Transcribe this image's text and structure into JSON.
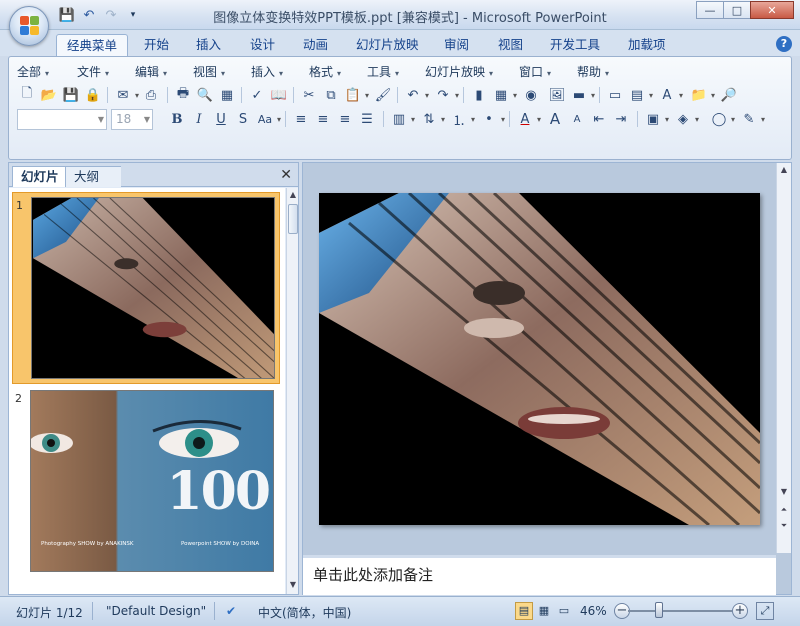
{
  "window": {
    "title": "图像立体变换特效PPT模板.ppt [兼容模式] - Microsoft PowerPoint",
    "controls": {
      "minimize": "—",
      "maximize": "□",
      "close": "✕"
    }
  },
  "quick_access": [
    "save-icon",
    "undo-icon",
    "redo-icon",
    "customize-icon"
  ],
  "ribbon_tabs": [
    "经典菜单",
    "开始",
    "插入",
    "设计",
    "动画",
    "幻灯片放映",
    "审阅",
    "视图",
    "开发工具",
    "加载项"
  ],
  "active_tab": "经典菜单",
  "menu": [
    "全部",
    "文件",
    "编辑",
    "视图",
    "插入",
    "格式",
    "工具",
    "幻灯片放映",
    "窗口",
    "帮助"
  ],
  "format": {
    "font_name": "",
    "font_size": "18"
  },
  "panel": {
    "tabs": [
      "幻灯片",
      "大纲"
    ],
    "close": "✕",
    "thumbnails": [
      {
        "number": "1",
        "selected": true
      },
      {
        "number": "2",
        "selected": false,
        "big_text": "100",
        "caption_left": "Photography SHOW by ANAKINSK",
        "caption_right": "Powerpoint SHOW by DOINA"
      }
    ]
  },
  "notes": {
    "placeholder": "单击此处添加备注"
  },
  "status": {
    "slide_info": "幻灯片 1/12",
    "theme": "\"Default Design\"",
    "language": "中文(简体，中国)",
    "zoom": "46%",
    "zoom_level_fraction": 0.3
  },
  "colors": {
    "accent": "#15428b",
    "selected_thumb": "#f8c56b",
    "slide_bg": "#000000"
  }
}
